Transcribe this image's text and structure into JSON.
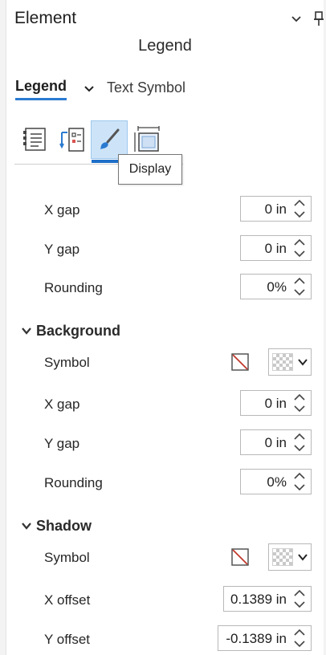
{
  "pane": {
    "title": "Element"
  },
  "subtitle": "Legend",
  "tabs": {
    "active": "Legend",
    "other": "Text Symbol"
  },
  "icon_tabs": [
    {
      "name": "options",
      "active": false
    },
    {
      "name": "arrangement",
      "active": false
    },
    {
      "name": "display",
      "active": true
    },
    {
      "name": "placement",
      "active": false
    }
  ],
  "tooltip": "Display",
  "frame": {
    "x_gap": {
      "label": "X gap",
      "value": "0 in"
    },
    "y_gap": {
      "label": "Y gap",
      "value": "0 in"
    },
    "rounding": {
      "label": "Rounding",
      "value": "0%"
    }
  },
  "background": {
    "header": "Background",
    "symbol_label": "Symbol",
    "x_gap": {
      "label": "X gap",
      "value": "0 in"
    },
    "y_gap": {
      "label": "Y gap",
      "value": "0 in"
    },
    "rounding": {
      "label": "Rounding",
      "value": "0%"
    }
  },
  "shadow": {
    "header": "Shadow",
    "symbol_label": "Symbol",
    "x_offset": {
      "label": "X offset",
      "value": "0.1389 in"
    },
    "y_offset": {
      "label": "Y offset",
      "value": "-0.1389 in"
    }
  },
  "colors": {
    "accent": "#2b7ad1",
    "active_tab_bg": "#cde4f8"
  }
}
